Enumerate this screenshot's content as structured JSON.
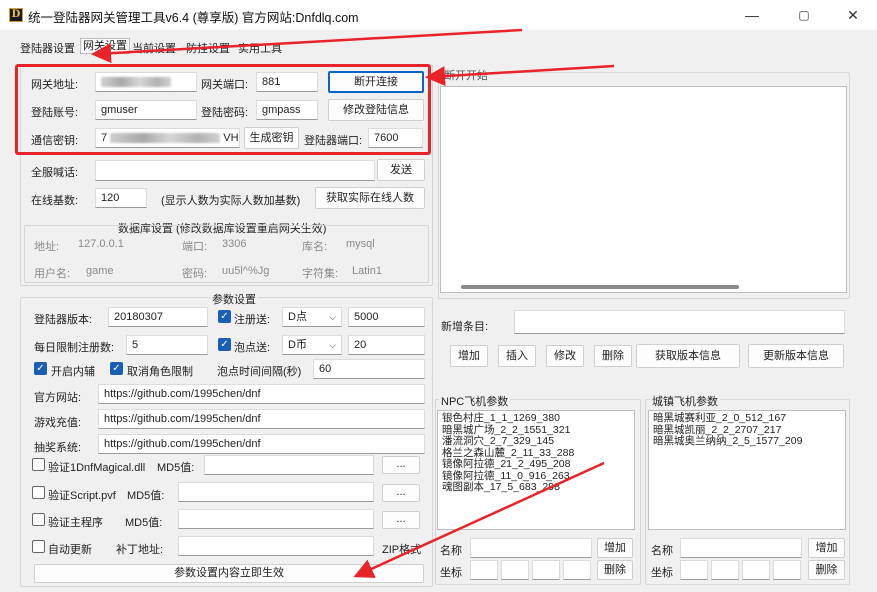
{
  "window": {
    "title": "统一登陆器网关管理工具v6.4 (尊享版) 官方网站:Dnfdlq.com",
    "app_icon": "D",
    "minimize": "—",
    "maximize": "▢",
    "close": "✕"
  },
  "tabs": [
    "登陆器设置",
    "网关设置",
    "当前设置",
    "防挂设置",
    "实用工具"
  ],
  "gateway": {
    "addr_label": "网关地址:",
    "port_label": "网关端口:",
    "port_value": "881",
    "disconnect_button": "断开连接",
    "account_label": "登陆账号:",
    "account_value": "gmuser",
    "password_label": "登陆密码:",
    "password_value": "gmpass",
    "modify_login_button": "修改登陆信息",
    "key_label": "通信密钥:",
    "key_prefix": "7",
    "key_suffix": "VH",
    "gen_key_button": "生成密钥",
    "launcher_port_label": "登陆器端口:",
    "launcher_port_value": "7600"
  },
  "broadcast": {
    "label": "全服喊话:",
    "send_button": "发送"
  },
  "online": {
    "label": "在线基数:",
    "value": "120",
    "note": "(显示人数为实际人数加基数)",
    "get_button": "获取实际在线人数"
  },
  "database": {
    "title": "数据库设置 (修改数据库设置重启网关生效)",
    "addr_label": "地址:",
    "addr_value": "127.0.0.1",
    "port_label": "端口:",
    "port_value": "3306",
    "lib_label": "库名:",
    "lib_value": "mysql",
    "user_label": "用户名:",
    "user_value": "game",
    "pwd_label": "密码:",
    "pwd_value": "uu5l^%Jg",
    "charset_label": "字符集:",
    "charset_value": "Latin1"
  },
  "params": {
    "title": "参数设置",
    "version_label": "登陆器版本:",
    "version_value": "20180307",
    "reg_send_label": "注册送:",
    "reg_send_type": "D点",
    "reg_send_value": "5000",
    "daily_limit_label": "每日限制注册数:",
    "daily_limit_value": "5",
    "point_send_label": "泡点送:",
    "point_send_type": "D币",
    "point_send_value": "20",
    "enable_assist_label": "开启内辅",
    "cancel_role_limit_label": "取消角色限制",
    "point_interval_label": "泡点时间间隔(秒)",
    "point_interval_value": "60",
    "website_label": "官方网站:",
    "website_value": "https://github.com/1995chen/dnf",
    "recharge_label": "游戏充值:",
    "recharge_value": "https://github.com/1995chen/dnf",
    "lottery_label": "抽奖系统:",
    "lottery_value": "https://github.com/1995chen/dnf",
    "verify_dll_label": "验证1DnfMagical.dll",
    "md5_label": "MD5值:",
    "verify_pvf_label": "验证Script.pvf",
    "verify_main_label": "验证主程序",
    "auto_update_label": "自动更新",
    "patch_label": "补丁地址:",
    "zip_label": "ZIP格式",
    "browse_button": "...",
    "apply_button": "参数设置内容立即生效"
  },
  "right_panel": {
    "broken_label": "断开开始",
    "new_entry_label": "新增条目:",
    "add_button": "增加",
    "insert_button": "插入",
    "modify_button": "修改",
    "delete_button": "删除",
    "get_version_button": "获取版本信息",
    "update_version_button": "更新版本信息"
  },
  "npc": {
    "title": "NPC飞机参数",
    "items": [
      "银色村庄_1_1_1269_380",
      "暗黑城广场_2_2_1551_321",
      "潘流洞穴_2_7_329_145",
      "格兰之森山麓_2_11_33_288",
      "镜像阿拉德_21_2_495_208",
      "镜像阿拉德_11_0_916_263",
      "魂图副本_17_5_683_298"
    ],
    "name_label": "名称",
    "coord_label": "坐标",
    "add_button": "增加",
    "delete_button": "删除"
  },
  "city": {
    "title": "城镇飞机参数",
    "items": [
      "暗黑城赛利亚_2_0_512_167",
      "暗黑城凯丽_2_2_2707_217",
      "暗黑城奥兰纳纳_2_5_1577_209"
    ],
    "name_label": "名称",
    "coord_label": "坐标",
    "add_button": "增加",
    "delete_button": "删除"
  },
  "colors": {
    "highlight": "#e8232a",
    "focus": "#0a64c8",
    "checkbox": "#1a5fb4"
  }
}
